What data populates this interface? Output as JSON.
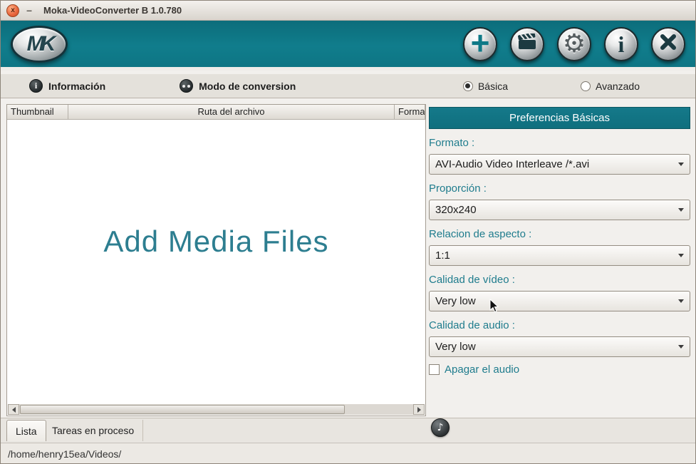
{
  "window": {
    "title": "Moka-VideoConverter B 1.0.780",
    "close_glyph": "x",
    "minimize_glyph": "–"
  },
  "header": {
    "logo_text": "MK",
    "icons": {
      "add": "+",
      "gear": "⚙",
      "info": "i",
      "music": "♪"
    }
  },
  "menubar": {
    "info_label": "Información",
    "mode_label": "Modo de conversion",
    "radio_basic": "Básica",
    "radio_advanced": "Avanzado"
  },
  "table": {
    "columns": [
      "Thumbnail",
      "Ruta del archivo",
      "Formato"
    ],
    "empty_text": "Add Media Files"
  },
  "preferences": {
    "title": "Preferencias Básicas",
    "fields": [
      {
        "label": "Formato :",
        "value": "AVI-Audio Video Interleave /*.avi"
      },
      {
        "label": "Proporción :",
        "value": "320x240"
      },
      {
        "label": "Relacion de aspecto :",
        "value": "1:1"
      },
      {
        "label": "Calidad de vídeo :",
        "value": "Very low"
      },
      {
        "label": "Calidad de audio :",
        "value": "Very low"
      }
    ],
    "audio_off_label": "Apagar el audio"
  },
  "tabs": {
    "list_label": "Lista",
    "tasks_label": "Tareas en proceso"
  },
  "statusbar": {
    "path": "/home/henry15ea/Videos/"
  },
  "colors": {
    "teal": "#0f7987",
    "accent_orange": "#e8633a"
  }
}
